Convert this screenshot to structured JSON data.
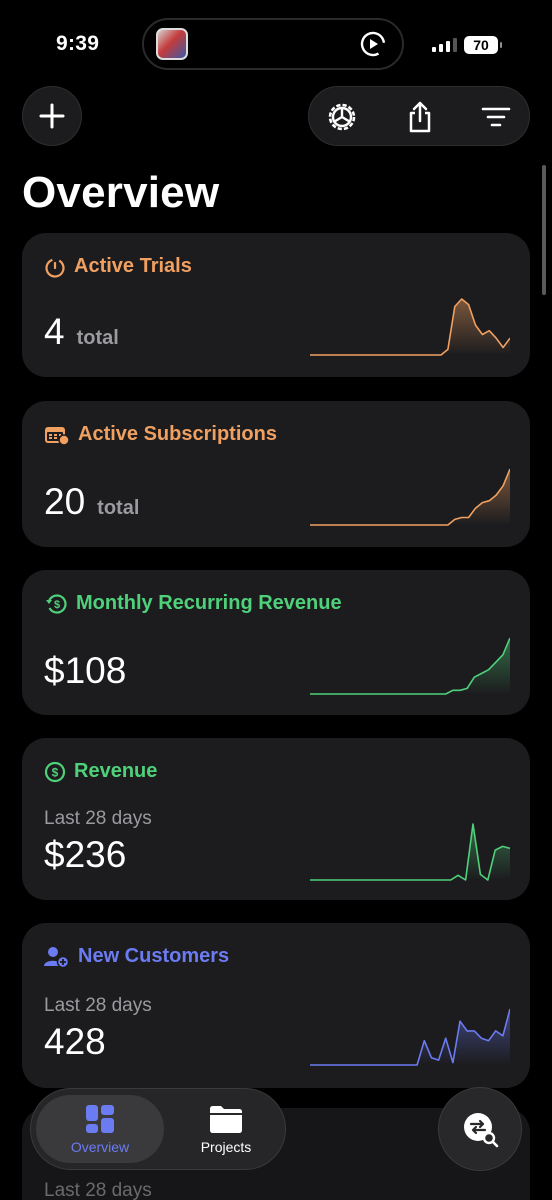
{
  "status_bar": {
    "time": "9:39",
    "battery": "70"
  },
  "page": {
    "title": "Overview"
  },
  "colors": {
    "orange": "#f0a060",
    "green": "#4fd07a",
    "blue": "#6b7bf2"
  },
  "cards": [
    {
      "title": "Active Trials",
      "icon": "timer-icon",
      "color": "#f0a060",
      "value": "4",
      "unit": "total"
    },
    {
      "title": "Active Subscriptions",
      "icon": "calendar-icon",
      "color": "#f0a060",
      "value": "20",
      "unit": "total"
    },
    {
      "title": "Monthly Recurring Revenue",
      "icon": "recurring-dollar-icon",
      "color": "#4fd07a",
      "value": "$108"
    },
    {
      "title": "Revenue",
      "icon": "dollar-circle-icon",
      "color": "#4fd07a",
      "subtitle": "Last 28 days",
      "value": "$236"
    },
    {
      "title": "New Customers",
      "icon": "add-person-icon",
      "color": "#6b7bf2",
      "subtitle": "Last 28 days",
      "value": "428"
    }
  ],
  "peek": {
    "subtitle": "Last 28 days"
  },
  "tabbar": {
    "overview_label": "Overview",
    "projects_label": "Projects"
  },
  "sparklines": {
    "trials": [
      0,
      0,
      0,
      0,
      0,
      0,
      0,
      0,
      0,
      0,
      0,
      0,
      0,
      0,
      0,
      0,
      0,
      0,
      0,
      0,
      0.3,
      2.6,
      3,
      2.7,
      1.6,
      1.1,
      1.3,
      0.9,
      0.4,
      0.9
    ],
    "subscriptions": [
      0,
      0,
      0,
      0,
      0,
      0,
      0,
      0,
      0,
      0,
      0,
      0,
      0,
      0,
      0,
      0,
      0,
      0,
      0,
      0,
      0,
      0.3,
      0.4,
      0.4,
      0.9,
      1.2,
      1.3,
      1.6,
      2.1,
      3
    ],
    "mrr": [
      0,
      0,
      0,
      0,
      0,
      0,
      0,
      0,
      0,
      0,
      0,
      0,
      0,
      0,
      0,
      0,
      0,
      0,
      0,
      0,
      0.2,
      0.2,
      0.3,
      0.9,
      1.1,
      1.3,
      1.7,
      2.1,
      3
    ],
    "revenue": [
      0,
      0,
      0,
      0,
      0,
      0,
      0,
      0,
      0,
      0,
      0,
      0,
      0,
      0,
      0,
      0,
      0,
      0,
      0,
      0,
      0.25,
      0,
      3,
      0.3,
      0,
      1.6,
      1.8,
      1.7
    ],
    "customers": [
      0,
      0,
      0,
      0,
      0,
      0,
      0,
      0,
      0,
      0,
      0,
      0,
      0,
      0,
      0,
      0,
      1,
      0.3,
      0.2,
      1.1,
      0.1,
      1.8,
      1.4,
      1.4,
      1.1,
      1,
      1.4,
      1.2,
      2.3
    ]
  }
}
